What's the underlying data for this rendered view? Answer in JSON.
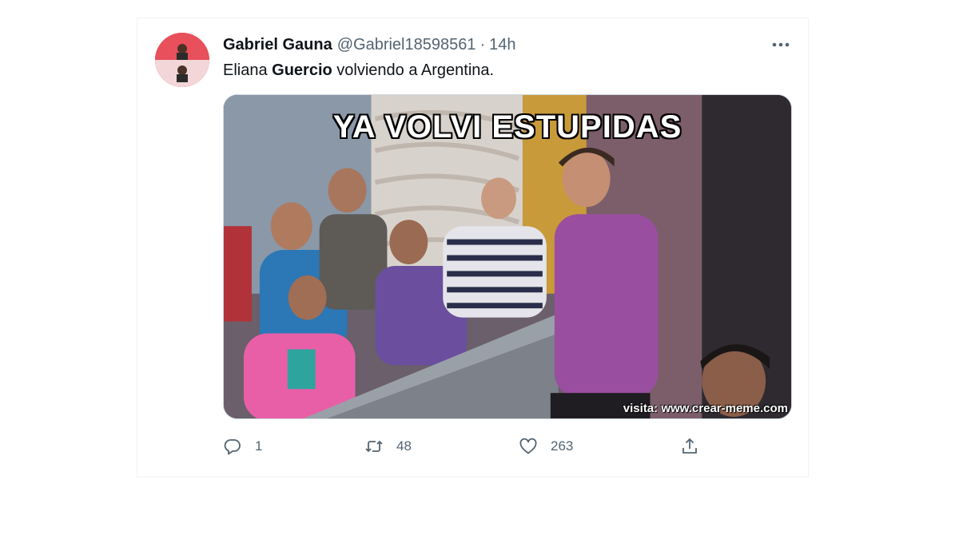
{
  "tweet": {
    "author": {
      "display_name": "Gabriel Gauna",
      "handle": "@Gabriel18598561",
      "separator": "·",
      "time": "14h"
    },
    "text": {
      "part1": "Eliana ",
      "bold": "Guercio",
      "part2": " volviendo a Argentina."
    },
    "media": {
      "caption": "YA VOLVI ESTUPIDAS",
      "watermark": "visita: www.crear-meme.com"
    },
    "actions": {
      "reply_count": "1",
      "retweet_count": "48",
      "like_count": "263"
    }
  },
  "icons": {
    "reply": "reply-icon",
    "retweet": "retweet-icon",
    "like": "heart-icon",
    "share": "share-icon",
    "more": "more-icon"
  },
  "colors": {
    "secondary_text": "#536471",
    "primary_text": "#0f1419",
    "border": "#eff3f4"
  }
}
